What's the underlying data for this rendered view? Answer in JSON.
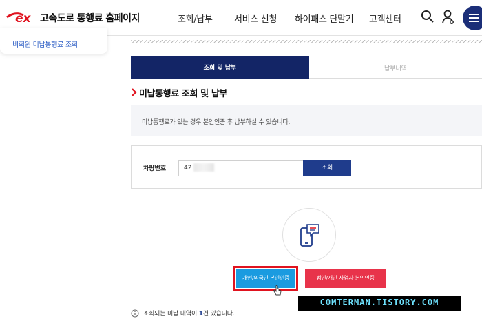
{
  "header": {
    "logo_text": "ex",
    "site_title": "고속도로 통행료 홈페이지",
    "nav": [
      "조회/납부",
      "서비스 신청",
      "하이패스 단말기",
      "고객센터"
    ],
    "icons": [
      "search-icon",
      "user-icon",
      "menu-icon"
    ],
    "brand_color": "#e0131f",
    "navy_color": "#1b2e78"
  },
  "sidebar": {
    "link_label": "비회원 미납통행료 조회"
  },
  "tabs": [
    {
      "label": "조회 및 납부",
      "active": true
    },
    {
      "label": "납부내역",
      "active": false
    }
  ],
  "section": {
    "title": "미납통행료 조회 및 납부",
    "info": "미납통행료가 있는 경우 본인인증 후 납부하실 수 있습니다."
  },
  "form": {
    "plate_label": "차량번호",
    "plate_value": "42",
    "search_label": "조회"
  },
  "auth": {
    "phone_icon": "mobile-chat-icon",
    "personal_label": "개인/외국인 본인인증",
    "corporate_label": "법인/개인 사업자 본인인증",
    "personal_color": "#1a9be0",
    "corporate_color": "#e8334a",
    "highlight_color": "#e0131f"
  },
  "notice": {
    "prefix": "조회되는 미납 내역이 ",
    "count": "1",
    "suffix": "건 있습니다."
  },
  "watermark": "COMTERMAN.TISTORY.COM"
}
